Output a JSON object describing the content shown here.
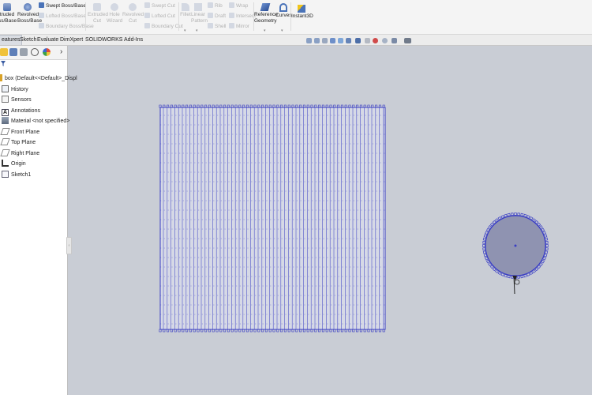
{
  "ribbon": {
    "extruded_boss": "truded\nss/Base",
    "revolved_boss": "Revolved\nBoss/Base",
    "swept_boss": "Swept Boss/Base",
    "lofted_boss": "Lofted Boss/Base",
    "boundary_boss": "Boundary Boss/Base",
    "extruded_cut": "Extruded\nCut",
    "hole_wizard": "Hole\nWizard",
    "revolved_cut": "Revolved\nCut",
    "swept_cut": "Swept Cut",
    "lofted_cut": "Lofted Cut",
    "boundary_cut": "Boundary Cut",
    "fillet": "Fillet",
    "linear_pattern": "Linear\nPattern",
    "rib": "Rib",
    "draft": "Draft",
    "shell": "Shell",
    "wrap": "Wrap",
    "intersect": "Intersect",
    "mirror": "Mirror",
    "reference_geometry": "Reference\nGeometry",
    "curves": "Curves",
    "instant3d": "Instant3D"
  },
  "tabs": [
    {
      "label": "eatures",
      "active": true
    },
    {
      "label": "Sketch",
      "active": false
    },
    {
      "label": "Evaluate",
      "active": false
    },
    {
      "label": "DimXpert",
      "active": false
    },
    {
      "label": "SOLIDWORKS Add-Ins",
      "active": false
    }
  ],
  "tree": {
    "root": "box  (Default<<Default>_Displ",
    "items": [
      {
        "label": "History",
        "icon": "history-icon"
      },
      {
        "label": "Sensors",
        "icon": "sensors-icon"
      },
      {
        "label": "Annotations",
        "icon": "annotations-icon"
      },
      {
        "label": "Material <not specified>",
        "icon": "material-icon"
      },
      {
        "label": "Front Plane",
        "icon": "plane-icon"
      },
      {
        "label": "Top Plane",
        "icon": "plane-icon"
      },
      {
        "label": "Right Plane",
        "icon": "plane-icon"
      },
      {
        "label": "Origin",
        "icon": "origin-icon"
      },
      {
        "label": "Sketch1",
        "icon": "sketch-icon"
      }
    ]
  },
  "colors": {
    "accent": "#3b3fc4",
    "viewport_bg": "#c9cdd5",
    "circle_fill": "#8f93b1"
  }
}
